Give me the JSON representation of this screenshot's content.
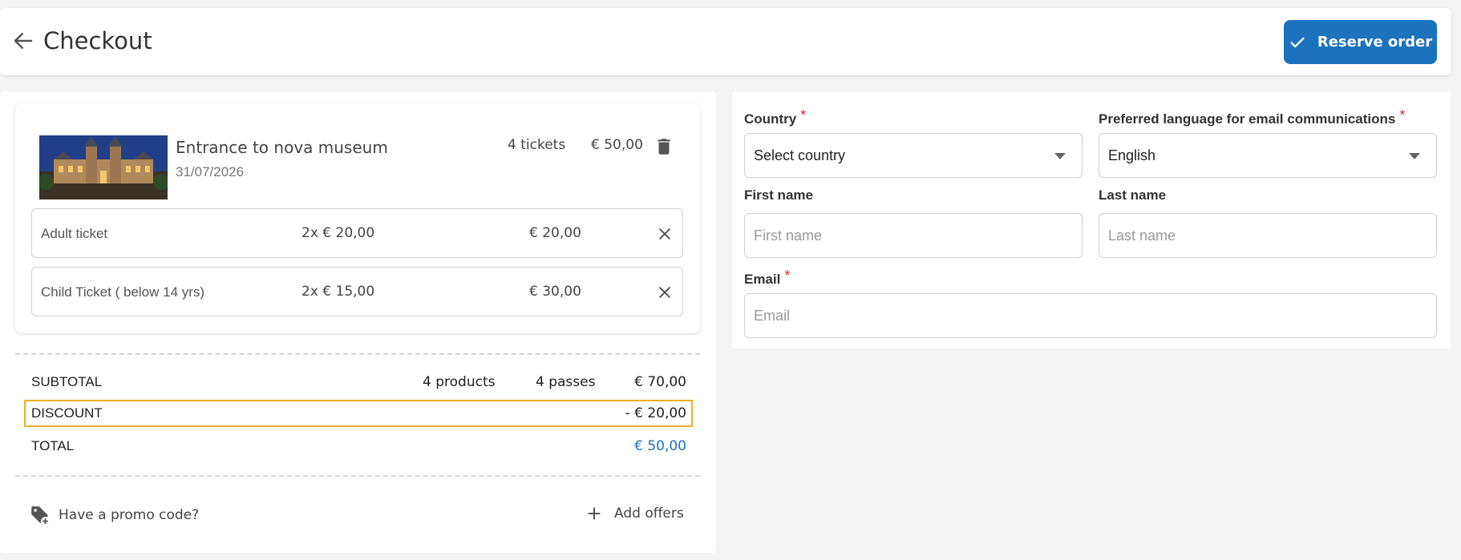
{
  "header": {
    "title": "Checkout",
    "reserve_label": "Reserve order"
  },
  "cart": {
    "product": {
      "name": "Entrance to nova museum",
      "date": "31/07/2026",
      "quantity": "4  tickets",
      "price": "€ 50,00"
    },
    "tickets": [
      {
        "name": "Adult ticket",
        "unit": "2x € 20,00",
        "total": "€ 20,00"
      },
      {
        "name": "Child Ticket ( below 14 yrs)",
        "unit": "2x € 15,00",
        "total": "€ 30,00"
      }
    ],
    "summary": {
      "subtotal_label": "SUBTOTAL",
      "products": "4 products",
      "passes": "4 passes",
      "subtotal": "€ 70,00",
      "discount_label": "DISCOUNT",
      "discount": "- € 20,00",
      "total_label": "TOTAL",
      "total": "€ 50,00"
    },
    "promo_label": "Have a promo code?",
    "offers_label": "Add offers"
  },
  "form": {
    "country": {
      "label": "Country",
      "value": "Select country",
      "required": "*"
    },
    "language": {
      "label": "Preferred language for email communications",
      "value": "English",
      "required": "*"
    },
    "first_name": {
      "label": "First name",
      "placeholder": "First name"
    },
    "last_name": {
      "label": "Last name",
      "placeholder": "Last name"
    },
    "email": {
      "label": "Email",
      "placeholder": "Email",
      "required": "*"
    }
  },
  "colors": {
    "accent": "#1c72bd",
    "required": "#d32f2f",
    "highlight": "#f0ad2a"
  }
}
